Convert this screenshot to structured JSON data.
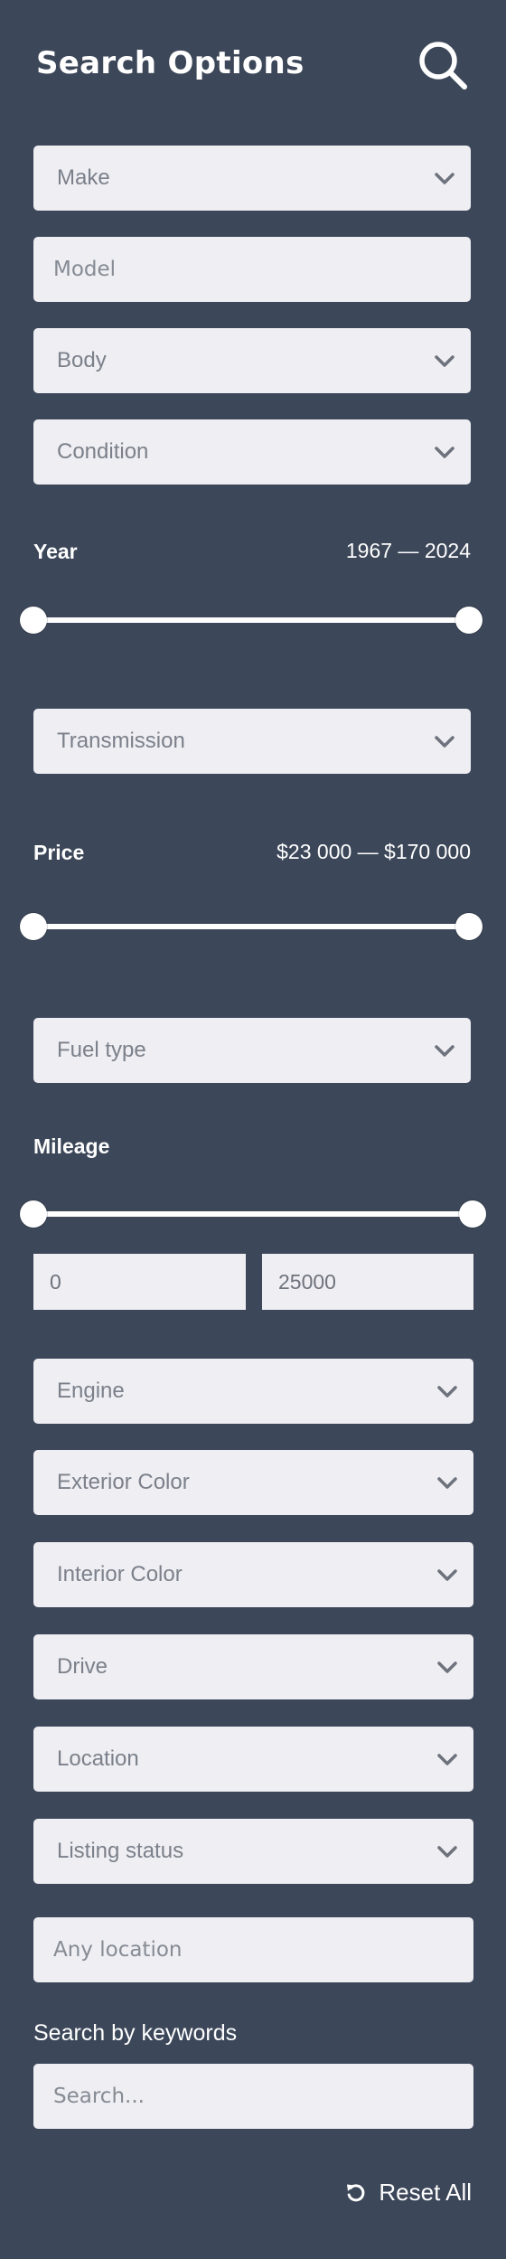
{
  "header": {
    "title": "Search Options",
    "search_icon": "magnifier-icon"
  },
  "filters": {
    "make": "Make",
    "model_placeholder": "Model",
    "body": "Body",
    "condition": "Condition",
    "transmission": "Transmission",
    "fuel_type": "Fuel type",
    "engine": "Engine",
    "exterior_color": "Exterior Color",
    "interior_color": "Interior Color",
    "drive": "Drive",
    "location": "Location",
    "listing_status": "Listing status",
    "any_location_placeholder": "Any location"
  },
  "year": {
    "label": "Year",
    "range_text": "1967 — 2024",
    "min": 1967,
    "max": 2024
  },
  "price": {
    "label": "Price",
    "range_text": "$23 000 — $170 000",
    "min": 23000,
    "max": 170000
  },
  "mileage": {
    "label": "Mileage",
    "min_value": "0",
    "max_value": "25000"
  },
  "keywords": {
    "label": "Search by keywords",
    "placeholder": "Search..."
  },
  "reset": {
    "label": "Reset All",
    "icon": "reset-icon"
  },
  "colors": {
    "background": "#3c4759",
    "field": "#eeeef3",
    "field_text": "#7b808a",
    "accent": "#ffffff"
  }
}
